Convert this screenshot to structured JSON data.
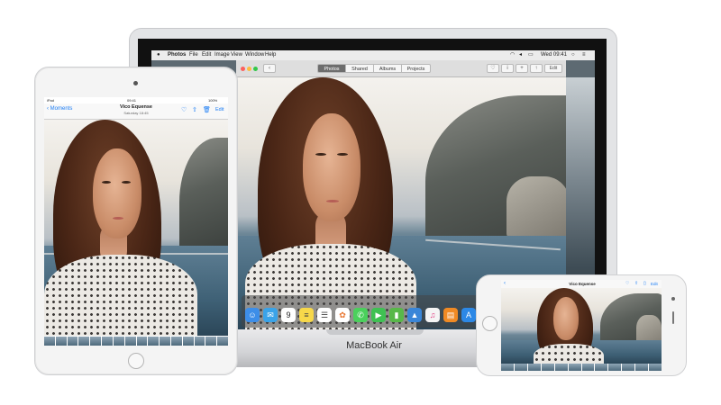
{
  "mac": {
    "brand": "MacBook Air",
    "menubar": {
      "apple": "",
      "app": "Photos",
      "items": [
        "File",
        "Edit",
        "Image",
        "View",
        "Window",
        "Help"
      ],
      "clock": "Wed 09:41"
    },
    "tabs": [
      "Photos",
      "Shared",
      "Albums",
      "Projects"
    ],
    "active_tab": "Photos",
    "toolbar_icons": [
      "heart-icon",
      "info-icon",
      "add-icon",
      "share-icon",
      "rotate-icon"
    ],
    "edit_label": "Edit",
    "dock_icons": [
      "finder",
      "mail",
      "calendar",
      "notes",
      "reminders",
      "photos",
      "messages",
      "facetime",
      "numbers",
      "keynote",
      "itunes",
      "ibooks"
    ],
    "calendar_day": "9"
  },
  "ipad": {
    "status_left": "iPad",
    "status_time": "09:41",
    "status_battery": "100%",
    "back_label": "Moments",
    "title": "Vico Equense",
    "subtitle": "Saturday 18:45",
    "edit_label": "Edit"
  },
  "iphone": {
    "title": "Vico Equense",
    "edit_label": "Edit"
  },
  "colors": {
    "accent": "#1a7cf5",
    "dock_bg": "#464646"
  }
}
